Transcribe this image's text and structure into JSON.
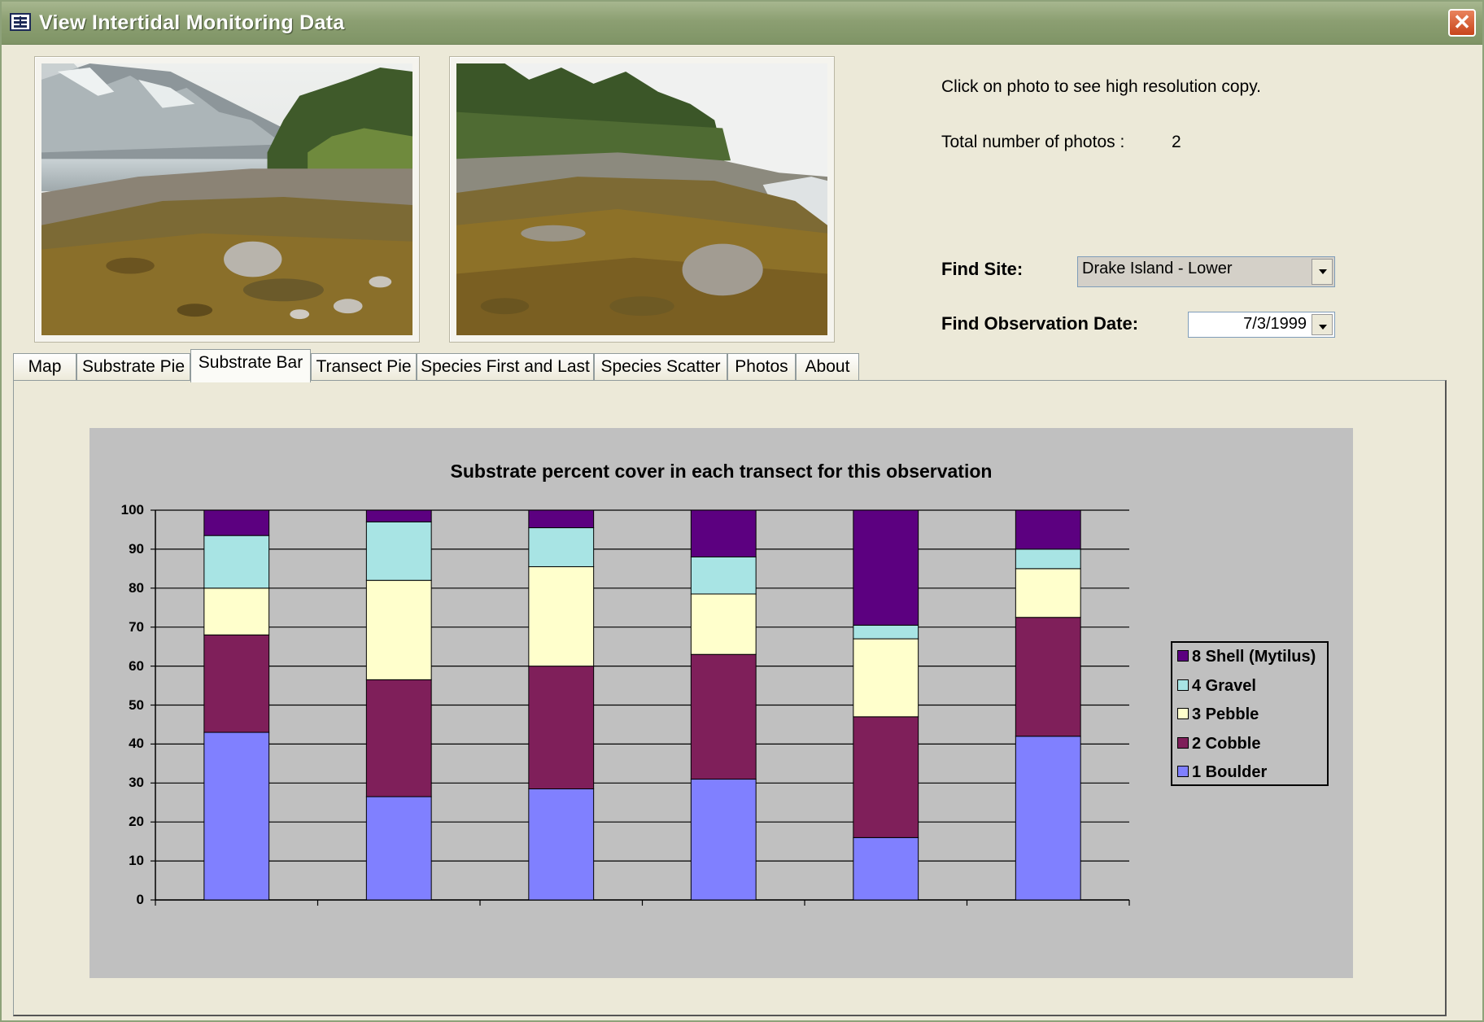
{
  "window": {
    "title": "View Intertidal Monitoring  Data",
    "close_label": "✕"
  },
  "photos_info": {
    "hint": "Click on photo to see high resolution copy.",
    "total_label": "Total number of photos :",
    "total_value": "2"
  },
  "filters": {
    "site_label": "Find Site:",
    "site_value": "Drake Island - Lower",
    "date_label": "Find Observation Date:",
    "date_value": "7/3/1999"
  },
  "tabs": [
    {
      "label": "Map"
    },
    {
      "label": "Substrate Pie"
    },
    {
      "label": "Substrate Bar"
    },
    {
      "label": "Transect Pie"
    },
    {
      "label": "Species First and Last"
    },
    {
      "label": "Species Scatter"
    },
    {
      "label": "Photos"
    },
    {
      "label": "About"
    }
  ],
  "active_tab": "Substrate Bar",
  "chart_data": {
    "type": "bar",
    "stacked": true,
    "title": "Substrate percent cover in each transect for this observation",
    "xlabel": "",
    "ylabel": "",
    "ylim": [
      0,
      100
    ],
    "yticks": [
      "0",
      "10",
      "20",
      "30",
      "40",
      "50",
      "60",
      "70",
      "80",
      "90",
      "100"
    ],
    "categories": [
      "",
      "",
      "",
      "",
      "",
      ""
    ],
    "grid": true,
    "legend_position": "right",
    "series": [
      {
        "name": "1 Boulder",
        "color": "#8080ff",
        "values": [
          43,
          26.5,
          28.5,
          31,
          16,
          42
        ]
      },
      {
        "name": "2 Cobble",
        "color": "#7f1f5a",
        "values": [
          25,
          30,
          31.5,
          32,
          31,
          30.5
        ]
      },
      {
        "name": "3 Pebble",
        "color": "#ffffcc",
        "values": [
          12,
          25.5,
          25.5,
          15.5,
          20,
          12.5
        ]
      },
      {
        "name": "4 Gravel",
        "color": "#a8e4e4",
        "values": [
          13.5,
          15,
          10,
          9.5,
          3.5,
          5
        ]
      },
      {
        "name": "8 Shell (Mytilus)",
        "color": "#5c0080",
        "values": [
          6.5,
          3,
          4.5,
          12,
          29.5,
          10
        ]
      }
    ]
  }
}
